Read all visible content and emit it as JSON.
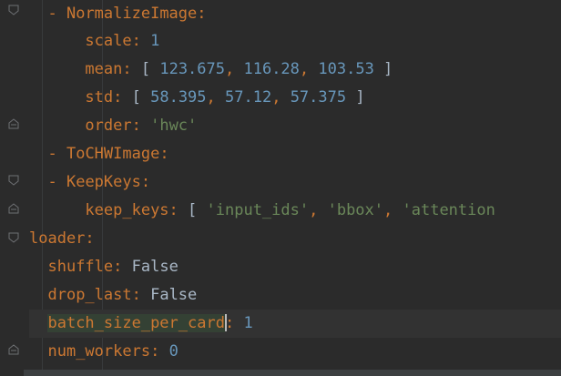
{
  "editor": {
    "lines": [
      {
        "indent": "  ",
        "dash": "- ",
        "key": "NormalizeImage",
        "colon": ":"
      },
      {
        "indent": "      ",
        "key": "scale",
        "colon": ": ",
        "value": "1",
        "value_type": "num"
      },
      {
        "indent": "      ",
        "key": "mean",
        "colon": ": ",
        "open": "[ ",
        "items": [
          "123.675",
          "116.28",
          "103.53"
        ],
        "close": " ]"
      },
      {
        "indent": "      ",
        "key": "std",
        "colon": ": ",
        "open": "[ ",
        "items": [
          "58.395",
          "57.12",
          "57.375"
        ],
        "close": " ]"
      },
      {
        "indent": "      ",
        "key": "order",
        "colon": ": ",
        "value": "'hwc'",
        "value_type": "str"
      },
      {
        "indent": "  ",
        "dash": "- ",
        "key": "ToCHWImage",
        "colon": ":"
      },
      {
        "indent": "  ",
        "dash": "- ",
        "key": "KeepKeys",
        "colon": ":"
      },
      {
        "indent": "      ",
        "key": "keep_keys",
        "colon": ": ",
        "open": "[ ",
        "str_items": [
          "'input_ids'",
          "'bbox'",
          "'attention"
        ]
      },
      {
        "indent": "",
        "key": "loader",
        "colon": ":"
      },
      {
        "indent": "  ",
        "key": "shuffle",
        "colon": ": ",
        "value": "False",
        "value_type": "plain"
      },
      {
        "indent": "  ",
        "key": "drop_last",
        "colon": ": ",
        "value": "False",
        "value_type": "plain"
      },
      {
        "indent": "  ",
        "key": "batch_size_per_card",
        "colon": ": ",
        "value": "1",
        "value_type": "num"
      },
      {
        "indent": "  ",
        "key": "num_workers",
        "colon": ": ",
        "value": "0",
        "value_type": "num"
      }
    ],
    "current_line_index": 11,
    "highlighted_key": "batch_size_per_card"
  },
  "colors": {
    "background": "#2b2b2b",
    "key": "#cc7832",
    "number": "#6897bb",
    "string": "#6a8759",
    "plain": "#a9b7c6",
    "current_line": "#323232",
    "identifier_highlight": "#344134"
  },
  "icons": {
    "fold_open": "fold-start-icon",
    "fold_close": "fold-end-icon"
  }
}
